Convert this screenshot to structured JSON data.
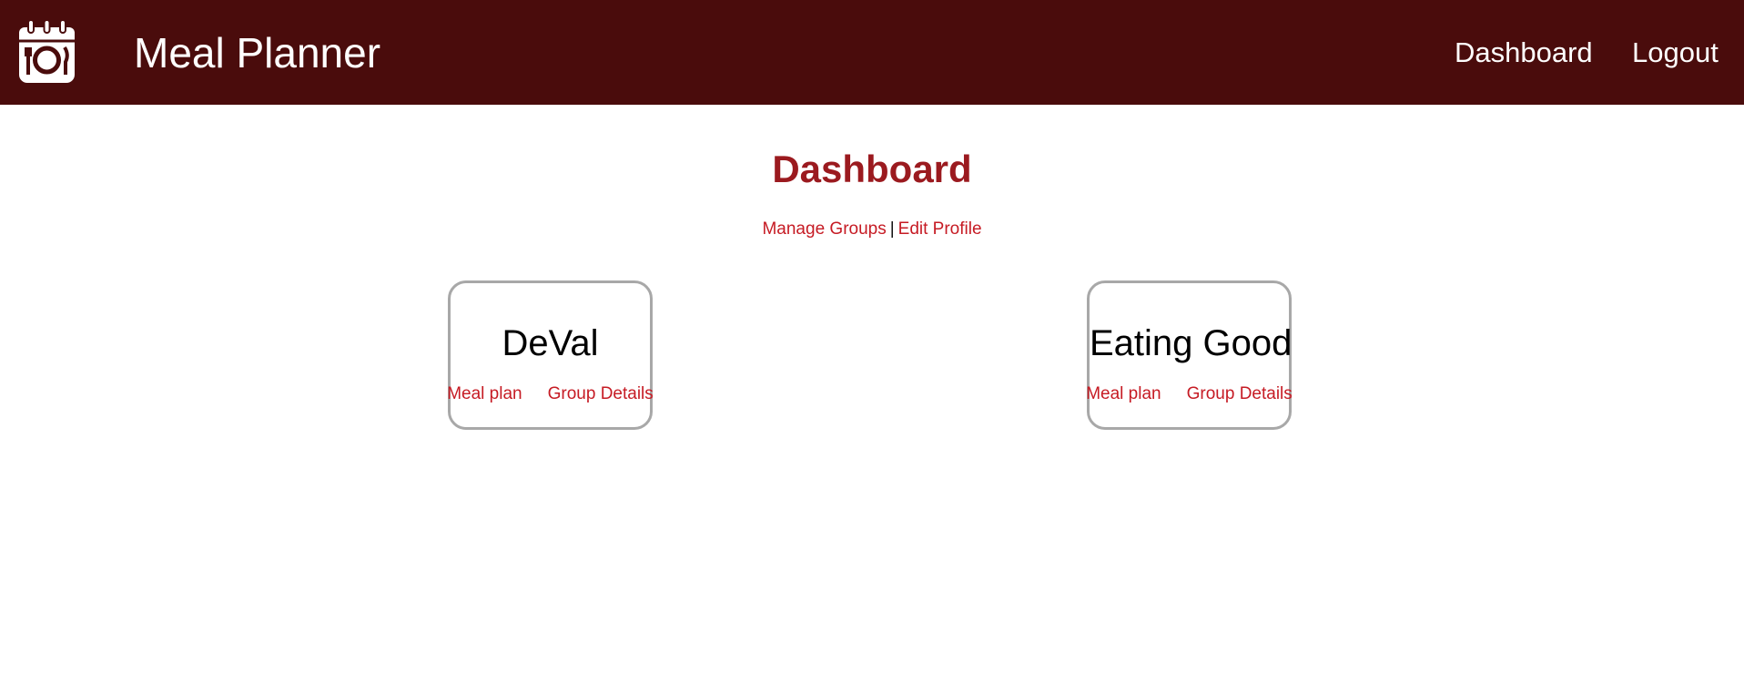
{
  "navbar": {
    "logo_icon": "calendar-plate-icon",
    "title": "Meal Planner",
    "links": [
      {
        "label": "Dashboard"
      },
      {
        "label": "Logout"
      }
    ],
    "background": "#4a0c0c"
  },
  "page": {
    "title": "Dashboard",
    "title_color": "#9b1a1f",
    "subnav": {
      "manage_groups": "Manage Groups",
      "separator": "|",
      "edit_profile": "Edit Profile"
    },
    "link_color": "#c61b24"
  },
  "groups": [
    {
      "name": "DeVal",
      "meal_plan_label": "Meal plan",
      "details_label": "Group Details"
    },
    {
      "name": "Eating Good",
      "meal_plan_label": "Meal plan",
      "details_label": "Group Details"
    }
  ]
}
